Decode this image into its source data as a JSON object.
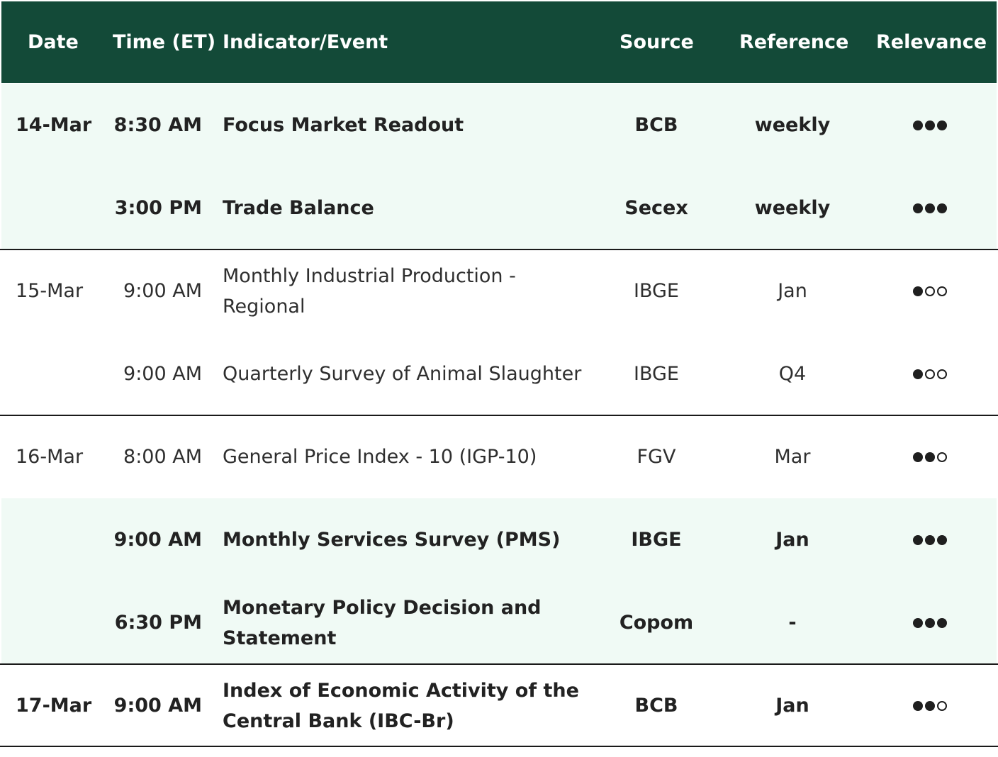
{
  "header": {
    "date": "Date",
    "time": "Time (ET)",
    "indicator": "Indicator/Event",
    "source": "Source",
    "reference": "Reference",
    "relevance": "Relevance"
  },
  "rows": [
    {
      "date": "14-Mar",
      "time": "8:30 AM",
      "indicator": "Focus Market Readout",
      "source": "BCB",
      "reference": "weekly",
      "relevance": 3,
      "bold": true,
      "shaded": true
    },
    {
      "date": "",
      "time": "3:00 PM",
      "indicator": "Trade Balance",
      "source": "Secex",
      "reference": "weekly",
      "relevance": 3,
      "bold": true,
      "shaded": true
    },
    {
      "date": "15-Mar",
      "time": "9:00 AM",
      "indicator": "Monthly Industrial Production - Regional",
      "source": "IBGE",
      "reference": "Jan",
      "relevance": 1,
      "bold": false,
      "shaded": false
    },
    {
      "date": "",
      "time": "9:00 AM",
      "indicator": "Quarterly Survey of Animal Slaughter",
      "source": "IBGE",
      "reference": "Q4",
      "relevance": 1,
      "bold": false,
      "shaded": false
    },
    {
      "date": "16-Mar",
      "time": "8:00 AM",
      "indicator": "General Price Index - 10 (IGP-10)",
      "source": "FGV",
      "reference": "Mar",
      "relevance": 2,
      "bold": false,
      "shaded": false
    },
    {
      "date": "",
      "time": "9:00 AM",
      "indicator": "Monthly Services Survey (PMS)",
      "source": "IBGE",
      "reference": "Jan",
      "relevance": 3,
      "bold": true,
      "shaded": true
    },
    {
      "date": "",
      "time": "6:30 PM",
      "indicator": "Monetary Policy Decision and Statement",
      "source": "Copom",
      "reference": "-",
      "relevance": 3,
      "bold": true,
      "shaded": true
    },
    {
      "date": "17-Mar",
      "time": "9:00 AM",
      "indicator": "Index of Economic Activity of the Central Bank (IBC-Br)",
      "source": "BCB",
      "reference": "Jan",
      "relevance": 2,
      "bold": true,
      "shaded": false
    }
  ],
  "colors": {
    "header_bg": "#134a38",
    "shaded_row_bg": "#f0faf5",
    "rule": "#1a1a1a"
  }
}
